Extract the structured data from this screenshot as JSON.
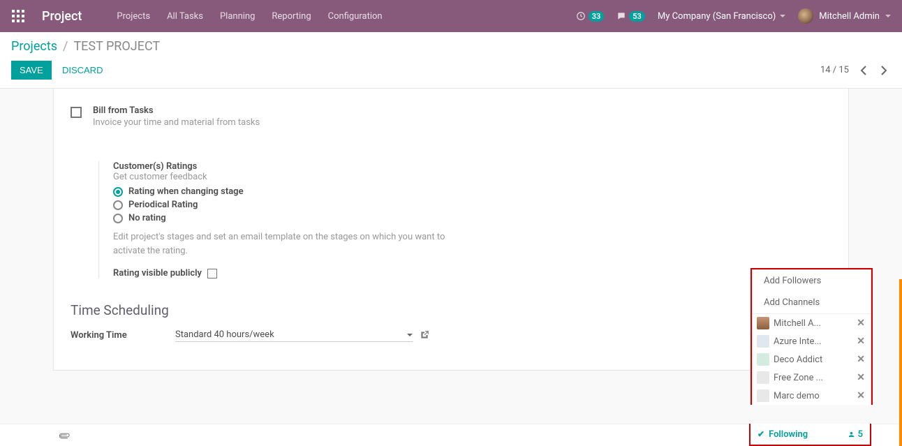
{
  "nav": {
    "brand": "Project",
    "menu": [
      "Projects",
      "All Tasks",
      "Planning",
      "Reporting",
      "Configuration"
    ],
    "activity_count": "33",
    "messages_count": "53",
    "company": "My Company (San Francisco)",
    "user": "Mitchell Admin"
  },
  "breadcrumb": {
    "root": "Projects",
    "current": "TEST PROJECT"
  },
  "buttons": {
    "save": "SAVE",
    "discard": "DISCARD"
  },
  "pager": {
    "text": "14 / 15"
  },
  "form": {
    "bill_label": "Bill from Tasks",
    "bill_help": "Invoice your time and material from tasks",
    "ratings_label": "Customer(s) Ratings",
    "ratings_sub": "Get customer feedback",
    "r1": "Rating when changing stage",
    "r2": "Periodical Rating",
    "r3": "No rating",
    "ratings_help": "Edit project's stages and set an email template on the stages on which you want to activate the rating.",
    "rating_public": "Rating visible publicly",
    "time_heading": "Time Scheduling",
    "working_label": "Working Time",
    "working_value": "Standard 40 hours/week"
  },
  "followers": {
    "add_followers": "Add Followers",
    "add_channels": "Add Channels",
    "list": [
      "Mitchell A...",
      "Azure Inte...",
      "Deco Addict",
      "Free Zone ...",
      "Marc demo"
    ],
    "following_label": "Following",
    "count": "5"
  }
}
